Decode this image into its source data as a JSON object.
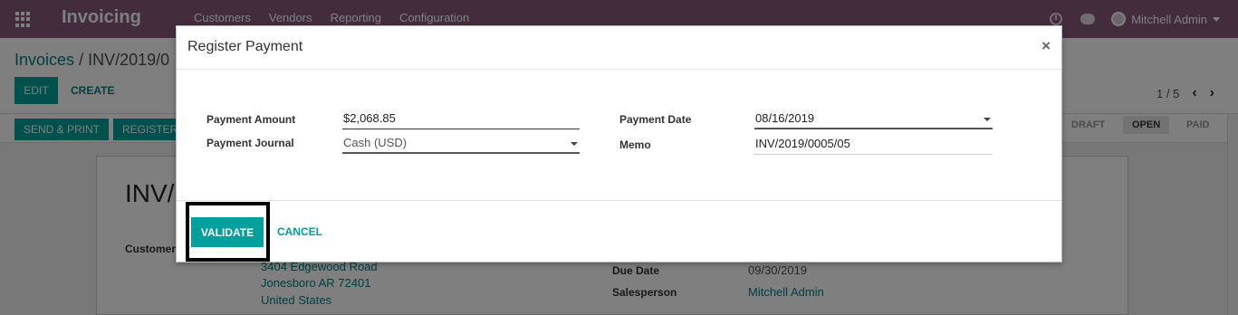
{
  "app": {
    "title": "Invoicing"
  },
  "menu": [
    "Customers",
    "Vendors",
    "Reporting",
    "Configuration"
  ],
  "user": {
    "name": "Mitchell Admin"
  },
  "breadcrumb": {
    "parent": "Invoices",
    "separator": "/",
    "current": "INV/2019/0"
  },
  "toolbar": {
    "edit_label": "EDIT",
    "create_label": "CREATE"
  },
  "pager": {
    "text": "1 / 5"
  },
  "statusbar": {
    "send_print_label": "SEND & PRINT",
    "register_label": "REGISTER",
    "stages": [
      "DRAFT",
      "OPEN",
      "PAID"
    ]
  },
  "sheet": {
    "title": "INV/",
    "customer_label": "Customer",
    "address_line1": "3404 Edgewood Road",
    "address_line2": "Jonesboro AR 72401",
    "address_line3": "United States",
    "due_date_label": "Due Date",
    "due_date_value": "09/30/2019",
    "salesperson_label": "Salesperson",
    "salesperson_value": "Mitchell Admin"
  },
  "modal": {
    "title": "Register Payment",
    "close_label": "×",
    "payment_amount_label": "Payment Amount",
    "payment_amount_value": "$2,068.85",
    "payment_journal_label": "Payment Journal",
    "payment_journal_value": "Cash (USD)",
    "payment_date_label": "Payment Date",
    "payment_date_value": "08/16/2019",
    "memo_label": "Memo",
    "memo_value": "INV/2019/0005/05",
    "validate_label": "VALIDATE",
    "cancel_label": "CANCEL"
  },
  "colors": {
    "navbar": "#875a7b",
    "primary": "#00a09d",
    "link": "#017e84"
  }
}
